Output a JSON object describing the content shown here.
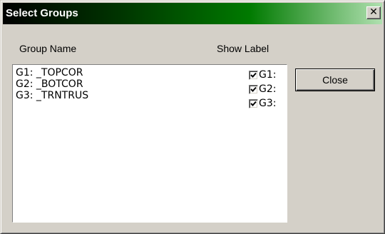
{
  "window": {
    "title": "Select Groups",
    "close_glyph": "✕"
  },
  "headers": {
    "group_name": "Group Name",
    "show_label": "Show Label"
  },
  "groups": [
    {
      "name": "G1: _TOPCOR",
      "label": "G1:",
      "show_label": true
    },
    {
      "name": "G2: _BOTCOR",
      "label": "G2:",
      "show_label": true
    },
    {
      "name": "G3: _TRNTRUS",
      "label": "G3:",
      "show_label": true
    }
  ],
  "buttons": {
    "close_label": "Close"
  },
  "colors": {
    "titlebar_start": "#000000",
    "titlebar_end": "#b0e0b0",
    "dialog_face": "#d4d0c8"
  }
}
